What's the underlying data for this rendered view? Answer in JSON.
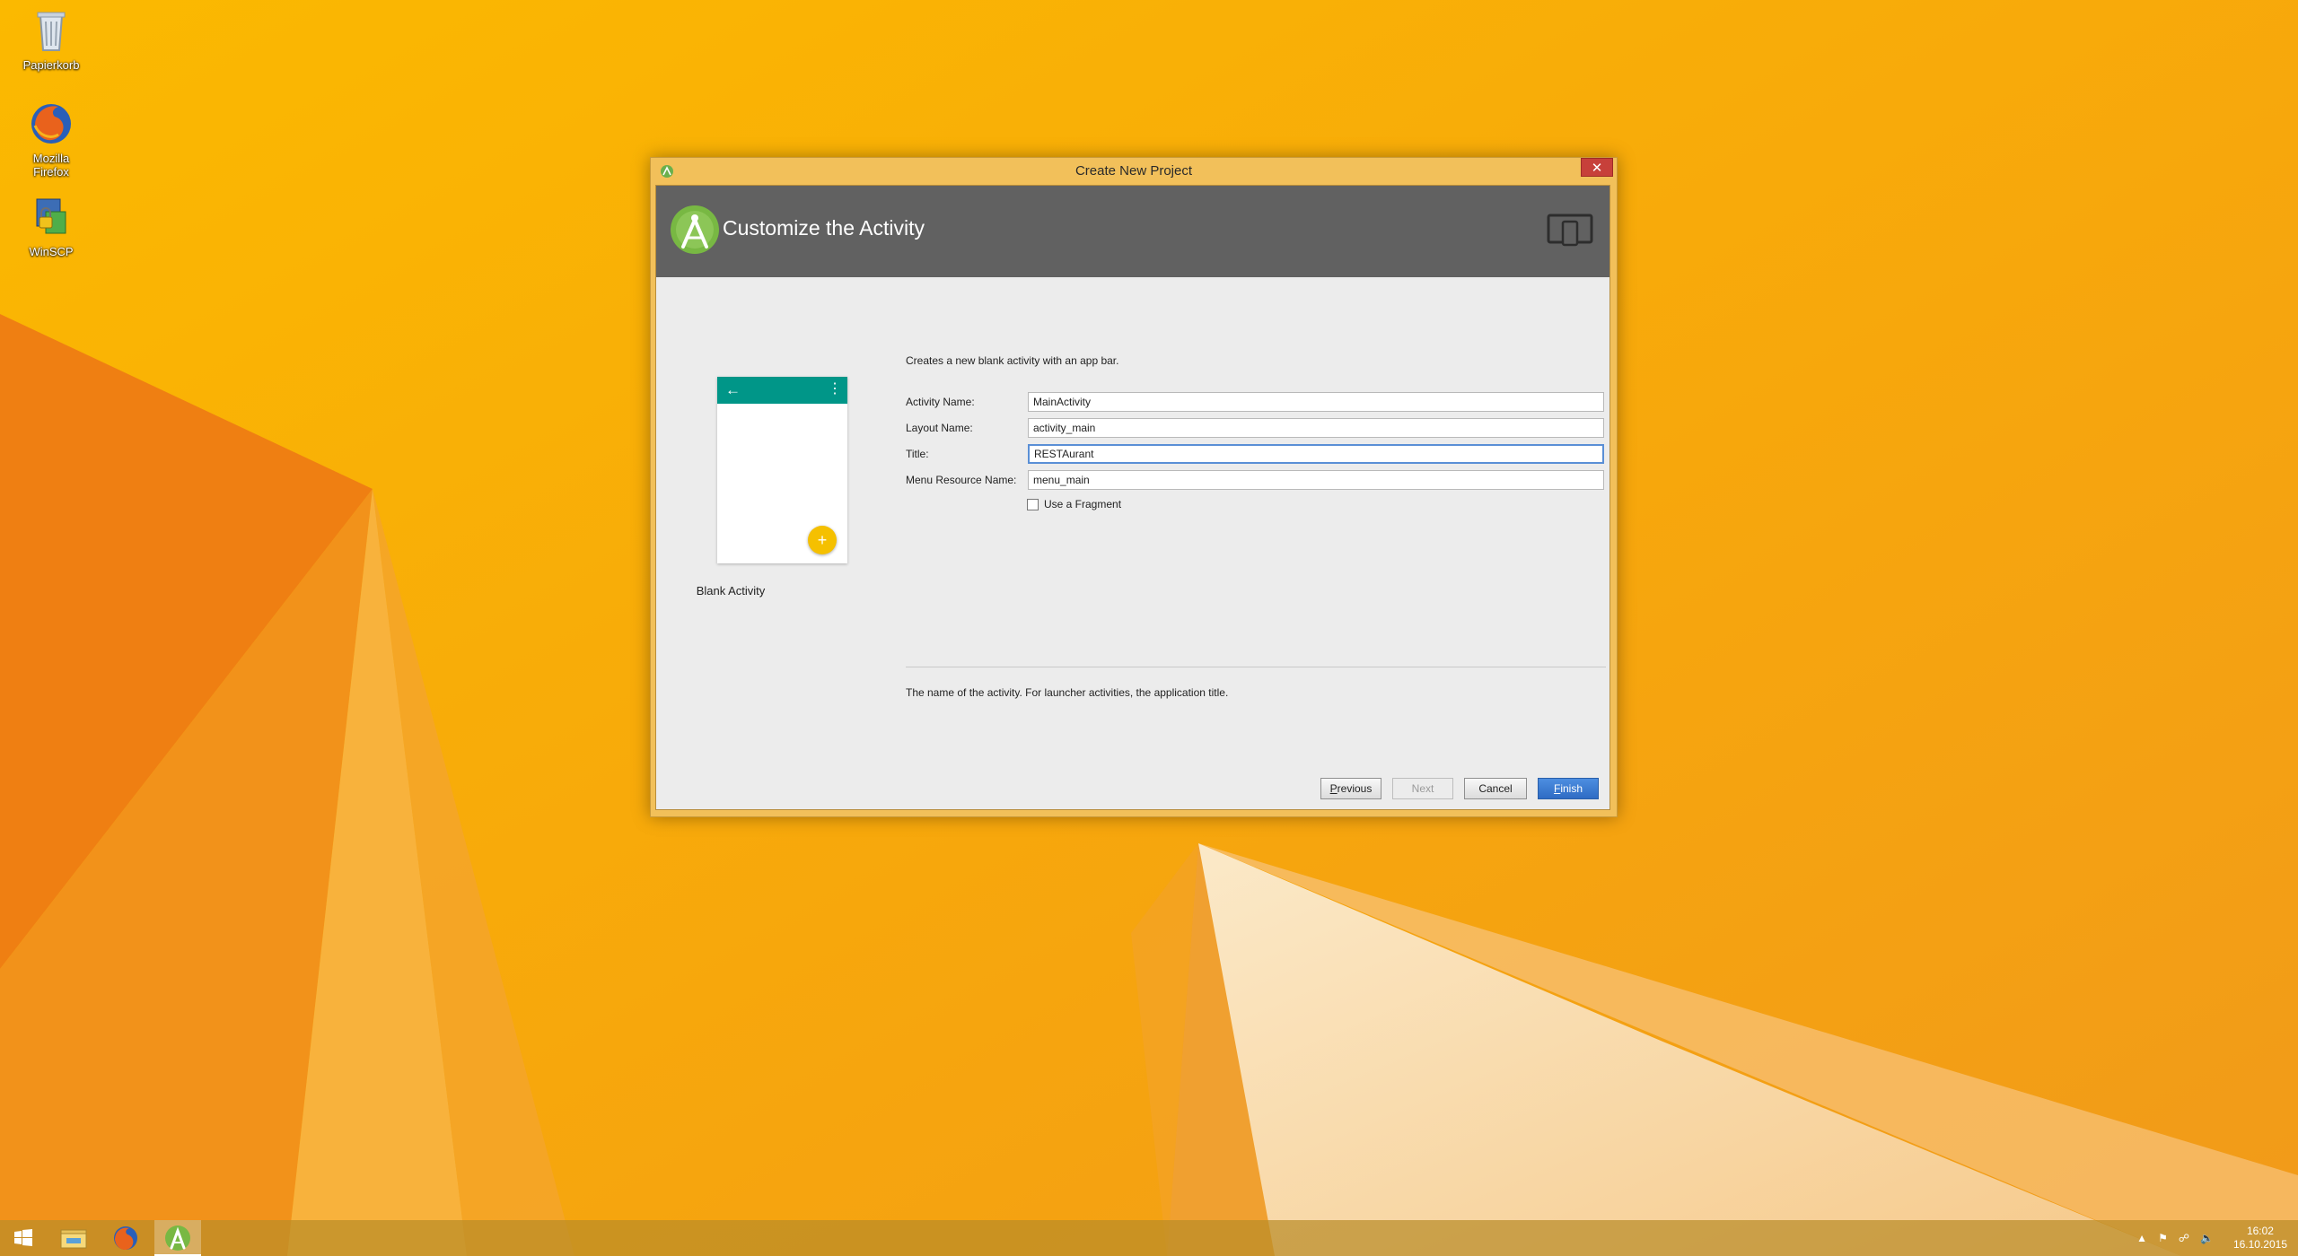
{
  "desktop": {
    "icons": [
      {
        "label": "Papierkorb",
        "icon": "recycle-bin-icon"
      },
      {
        "label": "Mozilla Firefox",
        "icon": "firefox-icon"
      },
      {
        "label": "WinSCP",
        "icon": "winscp-icon"
      }
    ]
  },
  "dialog": {
    "title": "Create New Project",
    "close_label": "✕",
    "header_title": "Customize the Activity",
    "description": "Creates a new blank activity with an app bar.",
    "preview_label": "Blank Activity",
    "fields": {
      "activity_name": {
        "label": "Activity Name:",
        "value": "MainActivity"
      },
      "layout_name": {
        "label": "Layout Name:",
        "value": "activity_main"
      },
      "title": {
        "label": "Title:",
        "value": "RESTAurant"
      },
      "menu_resource_name": {
        "label": "Menu Resource Name:",
        "value": "menu_main"
      }
    },
    "use_fragment": {
      "label": "Use a Fragment",
      "checked": false
    },
    "help_text": "The name of the activity. For launcher activities, the application title.",
    "buttons": {
      "previous_mnemonic": "P",
      "previous_rest": "revious",
      "next": "Next",
      "cancel": "Cancel",
      "finish_mnemonic": "F",
      "finish_rest": "inish"
    }
  },
  "taskbar": {
    "items": [
      "start-button",
      "file-explorer",
      "firefox",
      "android-studio"
    ],
    "clock": {
      "time": "16:02",
      "date": "16.10.2015"
    }
  },
  "colors": {
    "header": "#616161",
    "preview_appbar": "#009688",
    "fab": "#f5c000",
    "finish_button": "#2f6cc4"
  }
}
